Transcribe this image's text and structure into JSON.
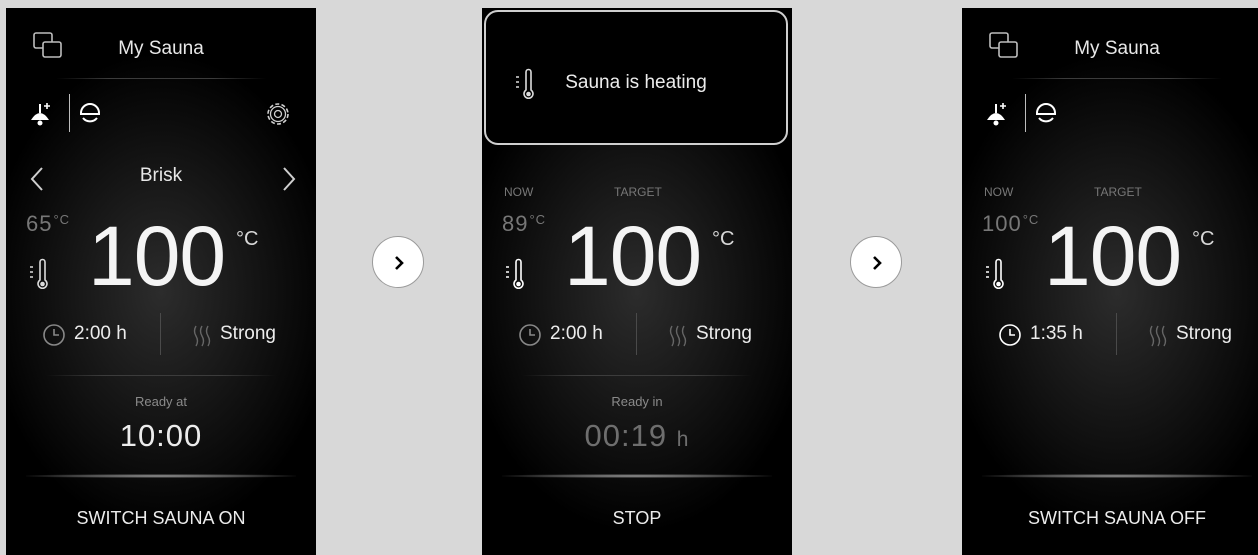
{
  "screen1": {
    "title": "My Sauna",
    "program": "Brisk",
    "current_temp": "65",
    "target_temp": "100",
    "temp_unit": "°C",
    "duration": "2:00 h",
    "intensity": "Strong",
    "info_label": "Ready at",
    "info_value": "10:00",
    "action": "SWITCH SAUNA ON"
  },
  "screen2": {
    "popup_message": "Sauna is heating",
    "now_label": "NOW",
    "target_label": "TARGET",
    "current_temp": "89",
    "target_temp": "100",
    "temp_unit": "°C",
    "duration": "2:00 h",
    "intensity": "Strong",
    "info_label": "Ready in",
    "info_value": "00:19",
    "info_unit": "h",
    "action": "STOP"
  },
  "screen3": {
    "title": "My Sauna",
    "now_label": "NOW",
    "target_label": "TARGET",
    "current_temp": "100",
    "target_temp": "100",
    "temp_unit": "°C",
    "duration": "1:35 h",
    "intensity": "Strong",
    "action": "SWITCH SAUNA OFF"
  },
  "icons": {
    "windows": "windows-icon",
    "light": "light-icon",
    "fan": "fan-icon",
    "settings": "gear-icon",
    "thermometer": "thermometer-icon",
    "timer": "clock-icon",
    "humidity": "steam-icon",
    "next": "chevron-right-icon"
  },
  "colors": {
    "background": "#d8d8d8",
    "screen": "#000000",
    "text": "#ececec",
    "muted": "#777777"
  }
}
